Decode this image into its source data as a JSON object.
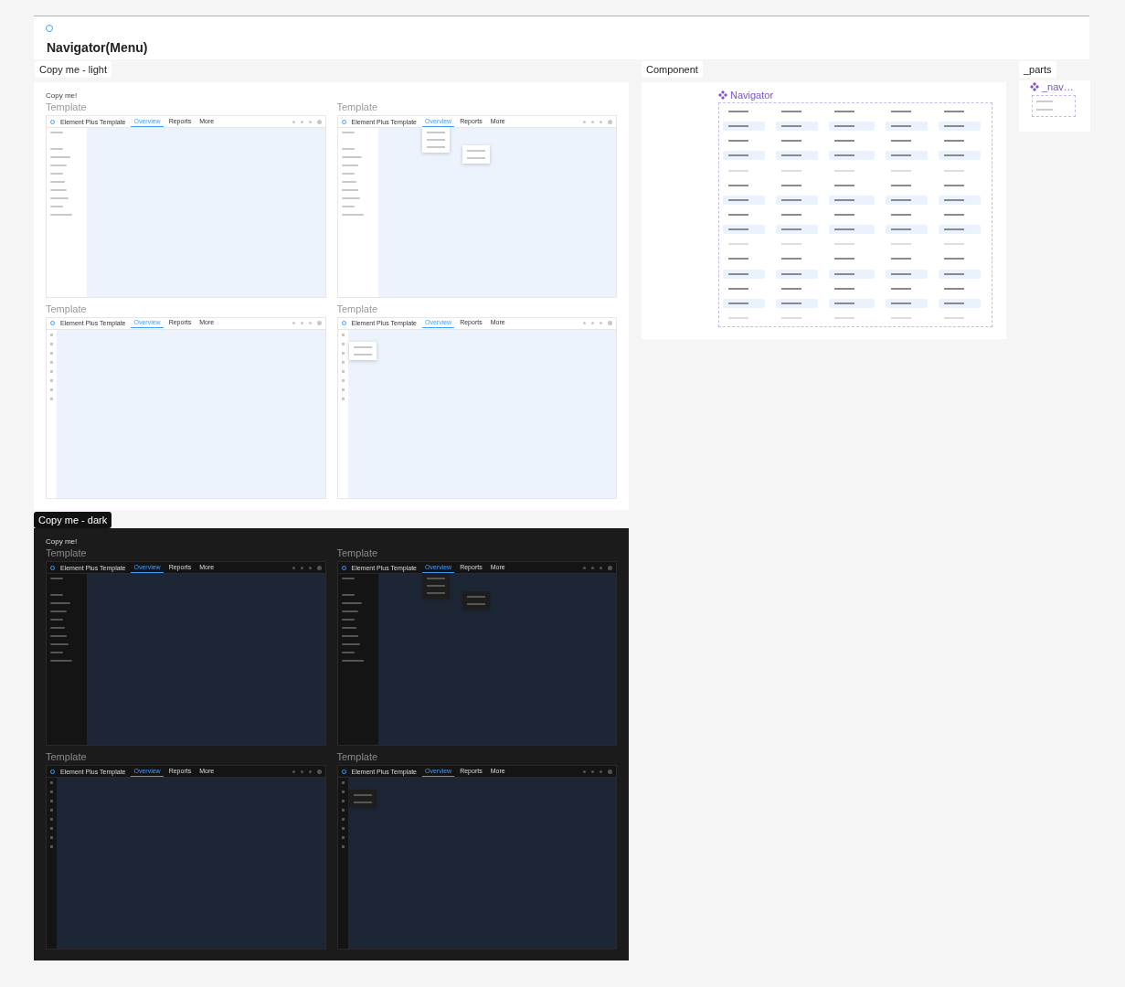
{
  "page": {
    "title": "Navigator(Menu)"
  },
  "sections": [
    {
      "label": "Copy me - light",
      "dark": false,
      "note": "Copy me!",
      "templates": [
        {
          "title": "Template",
          "app": "Element Plus Template",
          "sidebar_expanded": true,
          "tab_menu_open": false,
          "side_menu_open": false,
          "tabs": [
            {
              "label": "Overview",
              "selected": true
            },
            {
              "label": "Reports",
              "selected": false
            },
            {
              "label": "More",
              "selected": false
            }
          ]
        },
        {
          "title": "Template",
          "app": "Element Plus Template",
          "sidebar_expanded": true,
          "tab_menu_open": true,
          "side_menu_open": false,
          "tabs": [
            {
              "label": "Overview",
              "selected": true
            },
            {
              "label": "Reports",
              "selected": false
            },
            {
              "label": "More",
              "selected": false
            }
          ]
        },
        {
          "title": "Template",
          "app": "Element Plus Template",
          "sidebar_expanded": false,
          "tab_menu_open": false,
          "side_menu_open": false,
          "tabs": [
            {
              "label": "Overview",
              "selected": true
            },
            {
              "label": "Reports",
              "selected": false
            },
            {
              "label": "More",
              "selected": false
            }
          ]
        },
        {
          "title": "Template",
          "app": "Element Plus Template",
          "sidebar_expanded": false,
          "tab_menu_open": false,
          "side_menu_open": true,
          "tabs": [
            {
              "label": "Overview",
              "selected": true
            },
            {
              "label": "Reports",
              "selected": false
            },
            {
              "label": "More",
              "selected": false
            }
          ]
        }
      ]
    },
    {
      "label": "Copy me - dark",
      "dark": true,
      "note": "Copy me!",
      "templates": [
        {
          "title": "Template",
          "app": "Element Plus Template",
          "sidebar_expanded": true,
          "tab_menu_open": false,
          "side_menu_open": false,
          "tabs": [
            {
              "label": "Overview",
              "selected": true
            },
            {
              "label": "Reports",
              "selected": false
            },
            {
              "label": "More",
              "selected": false
            }
          ]
        },
        {
          "title": "Template",
          "app": "Element Plus Template",
          "sidebar_expanded": true,
          "tab_menu_open": true,
          "side_menu_open": false,
          "tabs": [
            {
              "label": "Overview",
              "selected": true
            },
            {
              "label": "Reports",
              "selected": false
            },
            {
              "label": "More",
              "selected": false
            }
          ]
        },
        {
          "title": "Template",
          "app": "Element Plus Template",
          "sidebar_expanded": false,
          "tab_menu_open": false,
          "side_menu_open": false,
          "tabs": [
            {
              "label": "Overview",
              "selected": true
            },
            {
              "label": "Reports",
              "selected": false
            },
            {
              "label": "More",
              "selected": false
            }
          ]
        },
        {
          "title": "Template",
          "app": "Element Plus Template",
          "sidebar_expanded": false,
          "tab_menu_open": false,
          "side_menu_open": true,
          "tabs": [
            {
              "label": "Overview",
              "selected": true
            },
            {
              "label": "Reports",
              "selected": false
            },
            {
              "label": "More",
              "selected": false
            }
          ]
        }
      ]
    }
  ],
  "component": {
    "label": "Component",
    "title": "Navigator",
    "rows": [
      {
        "disabled": false,
        "cells": [
          {
            "selected": false
          },
          {
            "selected": false
          },
          {
            "selected": false
          },
          {
            "selected": false
          },
          {
            "selected": false
          }
        ]
      },
      {
        "disabled": false,
        "cells": [
          {
            "selected": true
          },
          {
            "selected": true
          },
          {
            "selected": true
          },
          {
            "selected": true
          },
          {
            "selected": true
          }
        ]
      },
      {
        "disabled": false,
        "cells": [
          {
            "selected": false
          },
          {
            "selected": false
          },
          {
            "selected": false
          },
          {
            "selected": false
          },
          {
            "selected": false
          }
        ]
      },
      {
        "disabled": false,
        "cells": [
          {
            "selected": true
          },
          {
            "selected": true
          },
          {
            "selected": true
          },
          {
            "selected": true
          },
          {
            "selected": true
          }
        ]
      },
      {
        "disabled": true,
        "cells": [
          {
            "selected": false
          },
          {
            "selected": false
          },
          {
            "selected": false
          },
          {
            "selected": false
          },
          {
            "selected": false
          }
        ]
      },
      {
        "disabled": false,
        "cells": [
          {
            "selected": false
          },
          {
            "selected": false
          },
          {
            "selected": false
          },
          {
            "selected": false
          },
          {
            "selected": false
          }
        ]
      },
      {
        "disabled": false,
        "cells": [
          {
            "selected": true
          },
          {
            "selected": true
          },
          {
            "selected": true
          },
          {
            "selected": true
          },
          {
            "selected": true
          }
        ]
      },
      {
        "disabled": false,
        "cells": [
          {
            "selected": false
          },
          {
            "selected": false
          },
          {
            "selected": false
          },
          {
            "selected": false
          },
          {
            "selected": false
          }
        ]
      },
      {
        "disabled": false,
        "cells": [
          {
            "selected": true
          },
          {
            "selected": true
          },
          {
            "selected": true
          },
          {
            "selected": true
          },
          {
            "selected": true
          }
        ]
      },
      {
        "disabled": true,
        "cells": [
          {
            "selected": false
          },
          {
            "selected": false
          },
          {
            "selected": false
          },
          {
            "selected": false
          },
          {
            "selected": false
          }
        ]
      },
      {
        "disabled": false,
        "cells": [
          {
            "selected": false
          },
          {
            "selected": false
          },
          {
            "selected": false
          },
          {
            "selected": false
          },
          {
            "selected": false
          }
        ]
      },
      {
        "disabled": false,
        "cells": [
          {
            "selected": true
          },
          {
            "selected": true
          },
          {
            "selected": true
          },
          {
            "selected": true
          },
          {
            "selected": true
          }
        ]
      },
      {
        "disabled": false,
        "cells": [
          {
            "selected": false
          },
          {
            "selected": false
          },
          {
            "selected": false
          },
          {
            "selected": false
          },
          {
            "selected": false
          }
        ]
      },
      {
        "disabled": false,
        "cells": [
          {
            "selected": true
          },
          {
            "selected": true
          },
          {
            "selected": true
          },
          {
            "selected": true
          },
          {
            "selected": true
          }
        ]
      },
      {
        "disabled": true,
        "cells": [
          {
            "selected": false
          },
          {
            "selected": false
          },
          {
            "selected": false
          },
          {
            "selected": false
          },
          {
            "selected": false
          }
        ]
      }
    ]
  },
  "parts": {
    "label": "_parts",
    "title": "_nav…"
  }
}
